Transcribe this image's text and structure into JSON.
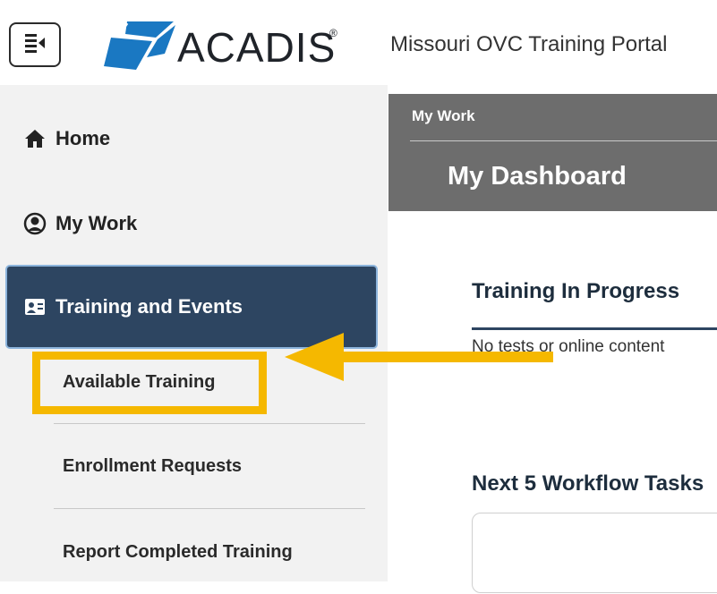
{
  "header": {
    "logo_text": "ACADIS",
    "logo_reg": "®",
    "portal_title": "Missouri OVC Training Portal",
    "menu_icon": "menu-collapse-icon"
  },
  "sidebar": {
    "items": [
      {
        "label": "Home",
        "icon": "home-icon"
      },
      {
        "label": "My Work",
        "icon": "user-circle-icon"
      },
      {
        "label": "Training and Events",
        "icon": "id-card-icon",
        "active": true
      }
    ],
    "sub_items": [
      {
        "label": "Available Training",
        "highlighted": true
      },
      {
        "label": "Enrollment Requests"
      },
      {
        "label": "Report Completed Training"
      }
    ],
    "active_color": "#2d4561"
  },
  "main": {
    "breadcrumb": "My Work",
    "page_title": "My Dashboard",
    "sections": [
      {
        "title": "Training In Progress",
        "empty_message": "No tests or online content"
      },
      {
        "title": "Next 5 Workflow Tasks"
      }
    ]
  },
  "annotation": {
    "highlight_color": "#f5b800",
    "arrow_color": "#f5b800"
  }
}
